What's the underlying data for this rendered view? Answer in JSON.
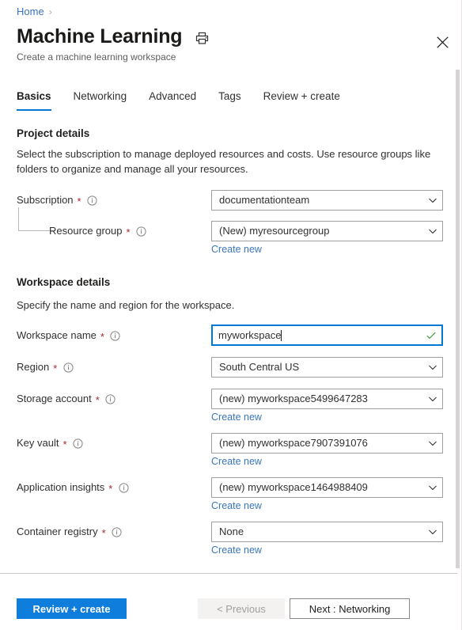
{
  "breadcrumb": {
    "home_label": "Home",
    "separator": "›"
  },
  "header": {
    "title": "Machine Learning",
    "subtitle": "Create a machine learning workspace",
    "print_icon": "print-icon",
    "close_icon": "close-icon"
  },
  "tabs": [
    {
      "label": "Basics",
      "active": true
    },
    {
      "label": "Networking",
      "active": false
    },
    {
      "label": "Advanced",
      "active": false
    },
    {
      "label": "Tags",
      "active": false
    },
    {
      "label": "Review + create",
      "active": false
    }
  ],
  "project_details": {
    "title": "Project details",
    "description": "Select the subscription to manage deployed resources and costs. Use resource groups like folders to organize and manage all your resources.",
    "fields": {
      "subscription": {
        "label": "Subscription",
        "required": "*",
        "value": "documentationteam"
      },
      "resource_group": {
        "label": "Resource group",
        "required": "*",
        "value": "(New) myresourcegroup",
        "create_new": "Create new"
      }
    }
  },
  "workspace_details": {
    "title": "Workspace details",
    "description": "Specify the name and region for the workspace.",
    "fields": {
      "workspace_name": {
        "label": "Workspace name",
        "required": "*",
        "value": "myworkspace",
        "validation_icon": "checkmark-icon",
        "focused": true
      },
      "region": {
        "label": "Region",
        "required": "*",
        "value": "South Central US"
      },
      "storage_account": {
        "label": "Storage account",
        "required": "*",
        "value": "(new) myworkspace5499647283",
        "create_new": "Create new"
      },
      "key_vault": {
        "label": "Key vault",
        "required": "*",
        "value": "(new) myworkspace7907391076",
        "create_new": "Create new"
      },
      "application_insights": {
        "label": "Application insights",
        "required": "*",
        "value": "(new) myworkspace1464988409",
        "create_new": "Create new"
      },
      "container_registry": {
        "label": "Container registry",
        "required": "*",
        "value": "None",
        "create_new": "Create new"
      }
    }
  },
  "footer": {
    "review_create": "Review + create",
    "previous": "< Previous",
    "next": "Next : Networking"
  },
  "colors": {
    "accent": "#0078d4",
    "primary_button": "#0f7ddb",
    "link": "#3b76bc",
    "required_star": "#a4262c",
    "success": "#3fa23f",
    "border": "#a19f9d"
  }
}
